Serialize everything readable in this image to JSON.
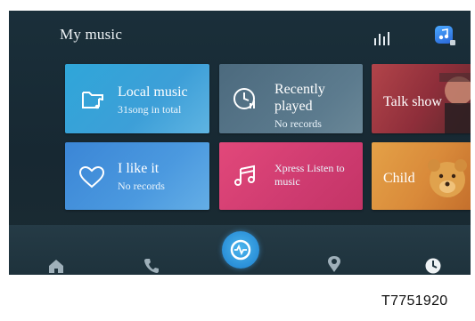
{
  "header": {
    "title": "My music",
    "icons": [
      "equalizer-icon",
      "music-app-icon"
    ]
  },
  "tiles": [
    {
      "name": "local-music",
      "title": "Local music",
      "subtitle": "31song in total",
      "icon": "folder-music-icon",
      "color": "#3aa3db"
    },
    {
      "name": "recently-played",
      "title": "Recently played",
      "subtitle": "No records",
      "icon": "clock-icon",
      "color": "#5a788b"
    },
    {
      "name": "talk-show",
      "title": "Talk show",
      "subtitle": "",
      "icon": "",
      "color": "#a33b44"
    },
    {
      "name": "i-like-it",
      "title": "I like it",
      "subtitle": "No records",
      "icon": "heart-icon",
      "color": "#438fdb"
    },
    {
      "name": "xpress-listen",
      "title": "Xpress Listen to music",
      "subtitle": "",
      "icon": "music-note-icon",
      "color": "#d83f74"
    },
    {
      "name": "child",
      "title": "Child",
      "subtitle": "",
      "icon": "",
      "color": "#dd933e"
    }
  ],
  "navbar": {
    "items": [
      "home-icon",
      "phone-icon",
      "media-icon",
      "navigation-icon",
      "clock-icon"
    ],
    "active": "media-icon",
    "accent": "#2f95dc"
  },
  "figure_code": "T7751920"
}
